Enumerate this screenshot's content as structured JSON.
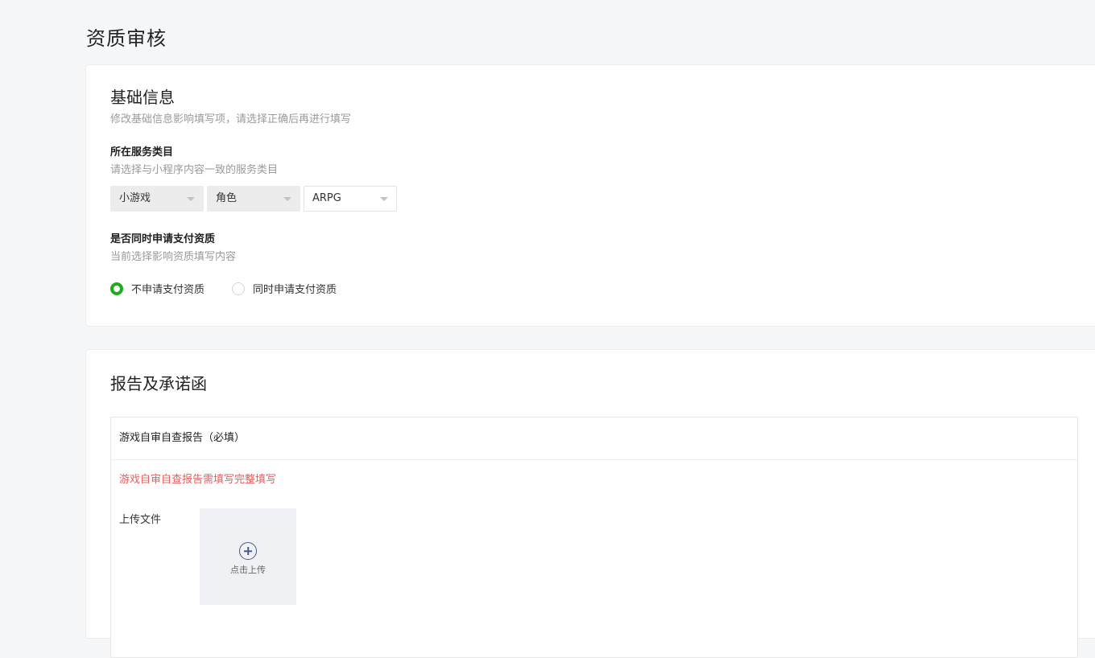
{
  "page": {
    "title": "资质审核"
  },
  "basic": {
    "title": "基础信息",
    "desc": "修改基础信息影响填写项，请选择正确后再进行填写",
    "category": {
      "label": "所在服务类目",
      "hint": "请选择与小程序内容一致的服务类目",
      "selects": [
        {
          "value": "小游戏",
          "state": "disabled"
        },
        {
          "value": "角色",
          "state": "disabled"
        },
        {
          "value": "ARPG",
          "state": "enabled"
        }
      ]
    },
    "payment": {
      "label": "是否同时申请支付资质",
      "hint": "当前选择影响资质填写内容",
      "options": [
        {
          "label": "不申请支付资质",
          "checked": true
        },
        {
          "label": "同时申请支付资质",
          "checked": false
        }
      ]
    }
  },
  "report": {
    "title": "报告及承诺函",
    "section": {
      "title": "游戏自审自查报告（必填）",
      "warning": "游戏自审自查报告需填写完整填写",
      "upload_label": "上传文件",
      "upload_button": "点击上传",
      "upload_icon": "plus-circle-icon"
    }
  },
  "colors": {
    "accent": "#1aad19",
    "warning": "#e15f5f",
    "background": "#f6f7f9"
  }
}
